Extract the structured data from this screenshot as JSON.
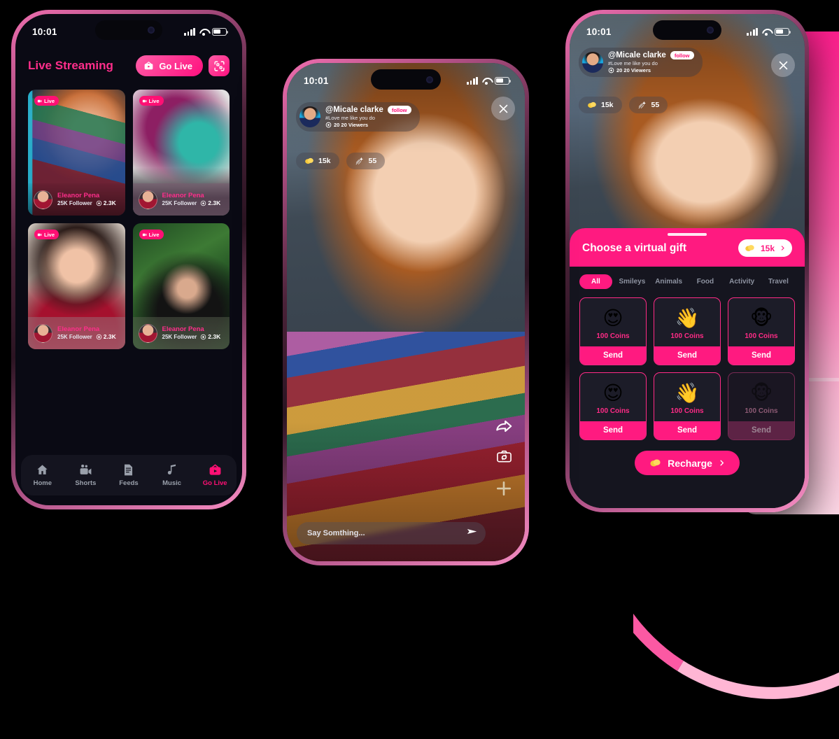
{
  "status_bar": {
    "time": "10:01",
    "signal_icon": "cellular-bars-icon",
    "wifi_icon": "wifi-icon",
    "battery_icon": "battery-icon"
  },
  "phone_left": {
    "header": {
      "title": "Live Streaming",
      "go_live_label": "Go Live",
      "go_live_icon": "tv-broadcast-icon",
      "qr_icon": "qr-scan-icon"
    },
    "cards": [
      {
        "live_label": "Live",
        "name": "Eleanor Pena",
        "followers": "25K Follower",
        "viewers": "2.3K",
        "viewer_icon": "eye-icon"
      },
      {
        "live_label": "Live",
        "name": "Eleanor Pena",
        "followers": "25K Follower",
        "viewers": "2.3K",
        "viewer_icon": "eye-icon"
      },
      {
        "live_label": "Live",
        "name": "Eleanor Pena",
        "followers": "25K Follower",
        "viewers": "2.3K",
        "viewer_icon": "eye-icon"
      },
      {
        "live_label": "Live",
        "name": "Eleanor Pena",
        "followers": "25K Follower",
        "viewers": "2.3K",
        "viewer_icon": "eye-icon"
      }
    ],
    "tabbar": [
      {
        "label": "Home",
        "icon": "home-icon",
        "active": false
      },
      {
        "label": "Shorts",
        "icon": "video-camera-icon",
        "active": false
      },
      {
        "label": "Feeds",
        "icon": "document-icon",
        "active": false
      },
      {
        "label": "Music",
        "icon": "music-note-icon",
        "active": false
      },
      {
        "label": "Go Live",
        "icon": "tv-broadcast-icon",
        "active": true
      }
    ]
  },
  "phone_mid": {
    "profile": {
      "username": "@Micale clarke",
      "follow_label": "follow",
      "hashtag": "#Love me like you do",
      "viewers": "20 20 Viewers",
      "viewer_icon": "eye-icon",
      "avatar": "user-avatar"
    },
    "close_icon": "close-icon",
    "stats": [
      {
        "icon": "coin-icon",
        "value": "15k"
      },
      {
        "icon": "shooting-star-icon",
        "value": "55"
      }
    ],
    "side_actions": [
      {
        "icon": "share-arrow-icon"
      },
      {
        "icon": "camera-flip-icon"
      },
      {
        "icon": "plus-icon"
      }
    ],
    "chat": {
      "placeholder": "Say Somthing...",
      "send_icon": "send-icon"
    }
  },
  "phone_right": {
    "profile": {
      "username": "@Micale clarke",
      "follow_label": "follow",
      "hashtag": "#Love me like you do",
      "viewers": "20 20 Viewers",
      "viewer_icon": "eye-icon",
      "avatar": "user-avatar"
    },
    "close_icon": "close-icon",
    "stats": [
      {
        "icon": "coin-icon",
        "value": "15k"
      },
      {
        "icon": "shooting-star-icon",
        "value": "55"
      }
    ],
    "gift_sheet": {
      "title": "Choose a virtual gift",
      "balance": "15k",
      "balance_icon": "coin-icon",
      "balance_chevron": "chevron-right-icon",
      "tabs": [
        {
          "label": "All",
          "active": true
        },
        {
          "label": "Smileys",
          "active": false
        },
        {
          "label": "Animals",
          "active": false
        },
        {
          "label": "Food",
          "active": false
        },
        {
          "label": "Activity",
          "active": false
        },
        {
          "label": "Travel",
          "active": false
        }
      ],
      "gifts": [
        {
          "emoji": "😍",
          "icon": "heart-eyes-emoji",
          "price": "100 Coins",
          "send_label": "Send",
          "disabled": false
        },
        {
          "emoji": "👋",
          "icon": "waving-hand-emoji",
          "price": "100 Coins",
          "send_label": "Send",
          "disabled": false
        },
        {
          "emoji": "🐵",
          "icon": "monkey-face-emoji",
          "price": "100 Coins",
          "send_label": "Send",
          "disabled": false
        },
        {
          "emoji": "😍",
          "icon": "heart-eyes-emoji",
          "price": "100 Coins",
          "send_label": "Send",
          "disabled": false
        },
        {
          "emoji": "👋",
          "icon": "waving-hand-emoji",
          "price": "100 Coins",
          "send_label": "Send",
          "disabled": false
        },
        {
          "emoji": "🐵",
          "icon": "monkey-face-emoji",
          "price": "100 Coins",
          "send_label": "Send",
          "disabled": true
        }
      ],
      "recharge_label": "Recharge",
      "recharge_icon": "coin-icon",
      "recharge_chevron": "chevron-right-icon"
    }
  },
  "colors": {
    "accent": "#ff1a80",
    "accent_bright": "#ff2e8b",
    "app_bg": "#0a0a14",
    "sheet_bg": "#15151f"
  }
}
